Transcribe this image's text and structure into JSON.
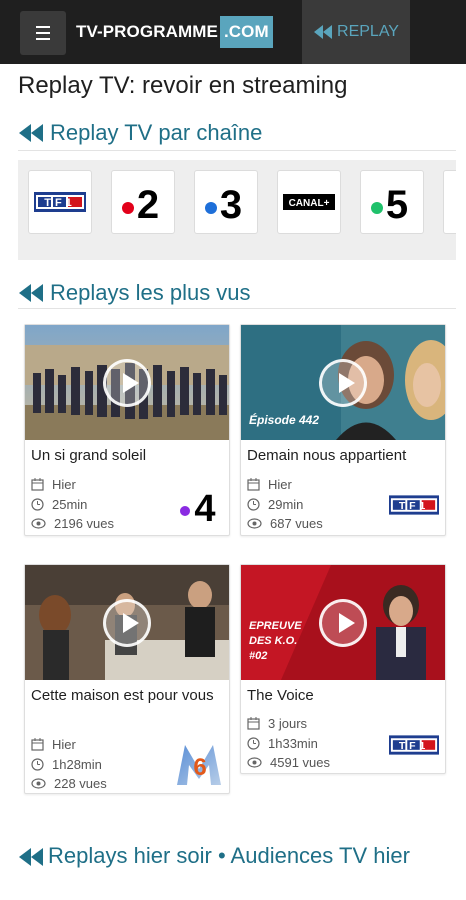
{
  "header": {
    "logo_main": "TV-PROGRAMME",
    "logo_accent": ".COM",
    "replay_tab": "REPLAY"
  },
  "page_title": "Replay TV: revoir en streaming",
  "sections": {
    "by_channel": "Replay TV par chaîne",
    "most_viewed": "Replays les plus vus",
    "last_night": "Replays hier soir • Audiences TV hier"
  },
  "channels": [
    {
      "name": "TF1",
      "icon": "tf1-logo"
    },
    {
      "name": "France 2",
      "icon": "france2-logo",
      "text": "2",
      "dot": "#e2001a"
    },
    {
      "name": "France 3",
      "icon": "france3-logo",
      "text": "3",
      "dot": "#1e6fd9"
    },
    {
      "name": "Canal+",
      "icon": "canalplus-logo",
      "text": "CANAL+"
    },
    {
      "name": "France 5",
      "icon": "france5-logo",
      "text": "5",
      "dot": "#1fc16b"
    }
  ],
  "replays": [
    {
      "title": "Un si grand soleil",
      "date": "Hier",
      "duration": "25min",
      "views": "2196 vues",
      "channel": "France 4",
      "channel_text": "4",
      "channel_dot": "#8a2be2",
      "thumb_label": ""
    },
    {
      "title": "Demain nous appartient",
      "date": "Hier",
      "duration": "29min",
      "views": "687 vues",
      "channel": "TF1",
      "thumb_label": "Épisode 442"
    },
    {
      "title": "Cette maison est pour vous",
      "date": "Hier",
      "duration": "1h28min",
      "views": "228 vues",
      "channel": "M6",
      "channel_text": "6",
      "thumb_label": ""
    },
    {
      "title": "The Voice",
      "date": "3 jours",
      "duration": "1h33min",
      "views": "4591 vues",
      "channel": "TF1",
      "thumb_label_lines": [
        "EPREUVE",
        "DES K.O.",
        "#02"
      ]
    }
  ],
  "colors": {
    "accent": "#1f6f87",
    "header_bg": "#1f1f1f",
    "logo_accent_bg": "#5aa5bd"
  },
  "tf1_text": "TF1"
}
